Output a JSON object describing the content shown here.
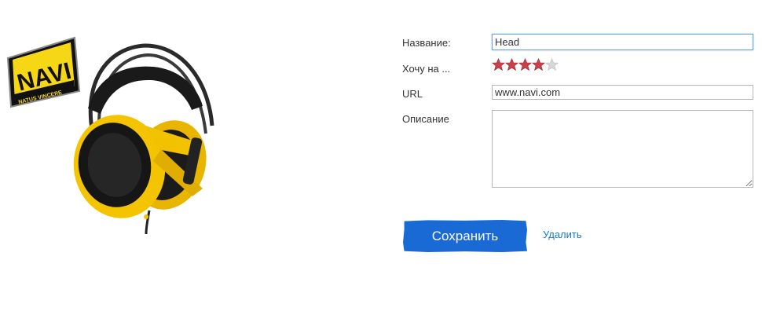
{
  "brand": {
    "logo_main": "NAVI",
    "logo_sub": "NATUS VINCERE",
    "logo_yellow": "#f5d716",
    "logo_black": "#111111"
  },
  "product": {
    "image_icon": "headset-icon"
  },
  "form": {
    "name_label": "Название:",
    "name_value": "Head",
    "want_label": "Хочу на ...",
    "rating": 4,
    "rating_max": 5,
    "star_filled_color": "#c9404a",
    "star_empty_color": "#d6d6d6",
    "url_label": "URL",
    "url_value": "www.navi.com",
    "description_label": "Описание",
    "description_value": ""
  },
  "actions": {
    "save_label": "Сохранить",
    "delete_label": "Удалить",
    "save_color": "#1a6ad6",
    "delete_color": "#1a7ac4"
  }
}
